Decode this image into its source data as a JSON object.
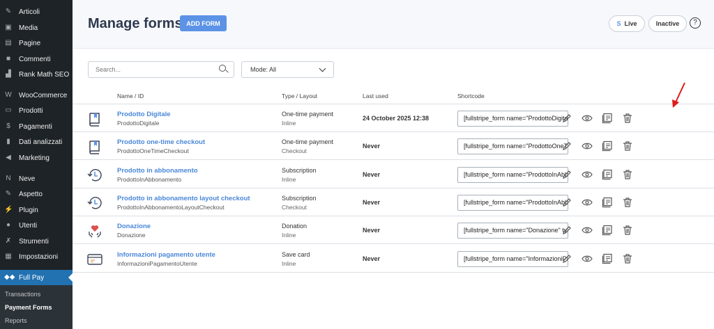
{
  "sidebar": {
    "items": [
      {
        "label": "Articoli",
        "icon": "pin-icon",
        "glyph": "✎"
      },
      {
        "label": "Media",
        "icon": "media-icon",
        "glyph": "▣"
      },
      {
        "label": "Pagine",
        "icon": "pages-icon",
        "glyph": "▤"
      },
      {
        "label": "Commenti",
        "icon": "comment-icon",
        "glyph": "■"
      },
      {
        "label": "Rank Math SEO",
        "icon": "rankmath-icon",
        "glyph": "▟"
      },
      {
        "label": "WooCommerce",
        "icon": "woo-icon",
        "glyph": "W"
      },
      {
        "label": "Prodotti",
        "icon": "products-icon",
        "glyph": "▭"
      },
      {
        "label": "Pagamenti",
        "icon": "payments-icon",
        "glyph": "$"
      },
      {
        "label": "Dati analizzati",
        "icon": "analytics-icon",
        "glyph": "▮"
      },
      {
        "label": "Marketing",
        "icon": "megaphone-icon",
        "glyph": "◀"
      },
      {
        "label": "Neve",
        "icon": "neve-icon",
        "glyph": "N"
      },
      {
        "label": "Aspetto",
        "icon": "brush-icon",
        "glyph": "✎"
      },
      {
        "label": "Plugin",
        "icon": "plugin-icon",
        "glyph": "⚡"
      },
      {
        "label": "Utenti",
        "icon": "user-icon",
        "glyph": "●"
      },
      {
        "label": "Strumenti",
        "icon": "wrench-icon",
        "glyph": "✗"
      },
      {
        "label": "Impostazioni",
        "icon": "settings-icon",
        "glyph": "▦"
      },
      {
        "label": "Full Pay",
        "icon": "fullpay-icon",
        "glyph": "◆◆"
      }
    ],
    "submenu": [
      "Transactions",
      "Payment Forms",
      "Reports"
    ]
  },
  "header": {
    "title": "Manage forms",
    "add_label": "ADD FORM",
    "live_s": "S",
    "live_label": "Live",
    "inactive_label": "Inactive",
    "help": "?"
  },
  "filters": {
    "search_placeholder": "Search...",
    "mode": "Mode: All"
  },
  "columns": [
    "Name / ID",
    "Type / Layout",
    "Last used",
    "Shortcode"
  ],
  "rows": [
    {
      "name": "Prodotto Digitale",
      "id": "ProdottoDigitale",
      "type": "One-time payment",
      "layout": "Inline",
      "last": "24 October 2025 12:38",
      "shortcode": "[fullstripe_form name=\"ProdottoDigitale\" type=\"inline_payment\"]",
      "icon": "book"
    },
    {
      "name": "Prodotto one-time checkout",
      "id": "ProdottoOneTimeCheckout",
      "type": "One-time payment",
      "layout": "Checkout",
      "last": "Never",
      "shortcode": "[fullstripe_form name=\"ProdottoOneTimeCheckout\" type=\"checkout_payment\"]",
      "icon": "book"
    },
    {
      "name": "Prodotto in abbonamento",
      "id": "ProdottoInAbbonamento",
      "type": "Subscription",
      "layout": "Inline",
      "last": "Never",
      "shortcode": "[fullstripe_form name=\"ProdottoInAbbonamento\" type=\"inline_subscription\"]",
      "icon": "history"
    },
    {
      "name": "Prodotto in abbonamento layout checkout",
      "id": "ProdottoInAbbonamentoLayoutCheckout",
      "type": "Subscription",
      "layout": "Checkout",
      "last": "Never",
      "shortcode": "[fullstripe_form name=\"ProdottoInAbbonamentoLayoutCheckout\" type=\"checkout_subscription\"]",
      "icon": "history"
    },
    {
      "name": "Donazione",
      "id": "Donazione",
      "type": "Donation",
      "layout": "Inline",
      "last": "Never",
      "shortcode": "[fullstripe_form name=\"Donazione\" type=\"inline_donation\"]",
      "icon": "heart"
    },
    {
      "name": "Informazioni pagamento utente",
      "id": "InformazioniPagamentoUtente",
      "type": "Save card",
      "layout": "Inline",
      "last": "Never",
      "shortcode": "[fullstripe_form name=\"InformazioniPagamentoUtente\" type=\"inline_save_card\"]",
      "icon": "card"
    }
  ]
}
